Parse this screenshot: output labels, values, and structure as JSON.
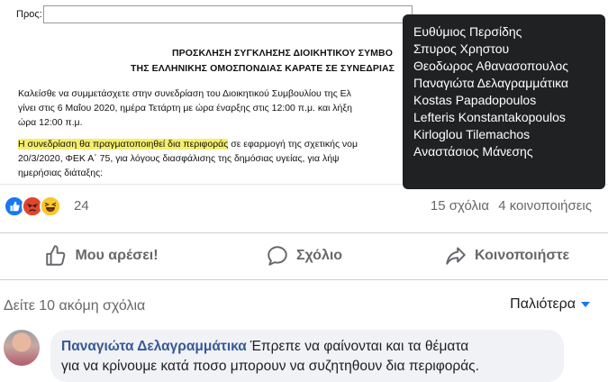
{
  "document": {
    "to_label": "Προς:",
    "title_line1": "ΠΡΟΣΚΛΗΣΗ ΣΥΓΚΛΗΣΗΣ ΔΙΟΙΚΗΤΙΚΟΥ ΣΥΜΒΟ",
    "title_line2": "ΤΗΣ ΕΛΛΗΝΙΚΗΣ ΟΜΟΣΠΟΝΔΙΑΣ ΚΑΡΑΤΕ ΣΕ ΣΥΝΕΔΡΙΑΣ",
    "para1_line1": "Καλείσθε να συμμετάσχετε στην συνεδρίαση του Διοικητικού Συμβουλίου της Ελ",
    "para1_line2": "γίνει στις 6 Μαΐου 2020, ημέρα Τετάρτη με ώρα έναρξης στις 12:00 π.μ. και λήξη",
    "para1_line3": "ώρα 12:00 π.μ.",
    "para2_highlight": "Η συνεδρίαση θα πραγματοποιηθεί δια περιφοράς",
    "para2_line1_rest": " σε εφαρμογή της σχετικής νομ",
    "para2_line2": "20/3/2020, ΦΕΚ Α΄ 75, για λόγους διασφάλισης της δημόσιας υγείας, για λήψ",
    "para2_line3": "ημερήσιας διάταξης:"
  },
  "tooltip": {
    "names": [
      "Ευθύμιος Περσίδης",
      "Σπυρος Χρηστου",
      "Θεοδωρος Αθανασοπουλος",
      "Παναγιώτα Δελαγραμμάτικα",
      "Kostas Papadopoulos",
      "Lefteris Konstantakopoulos",
      "Kirloglou Tilemachos",
      "Αναστάσιος Μάνεσης"
    ]
  },
  "reactions": {
    "count": "24",
    "icons": [
      "like-icon",
      "angry-icon",
      "haha-icon"
    ],
    "comments_count": "15 σχόλια",
    "shares_count": "4 κοινοποιήσεις"
  },
  "actions": {
    "like": "Μου αρέσει!",
    "comment": "Σχόλιο",
    "share": "Κοινοποιήστε"
  },
  "comments": {
    "view_more": "Δείτε 10 ακόμη σχόλια",
    "sort_label": "Παλιότερα",
    "first": {
      "author": "Παναγιώτα Δελαγραμμάτικα",
      "text_line1": "Έπρεπε να φαίνονται και τα θέματα",
      "text_line2": "για να κρίνουμε κατά ποσο μπορουν να συζητηθουν δια περιφοράς."
    }
  },
  "colors": {
    "accent": "#1877f2",
    "tooltip_bg": "#202122",
    "bubble_bg": "#f0f2f5",
    "highlight": "#f5ef6a"
  }
}
